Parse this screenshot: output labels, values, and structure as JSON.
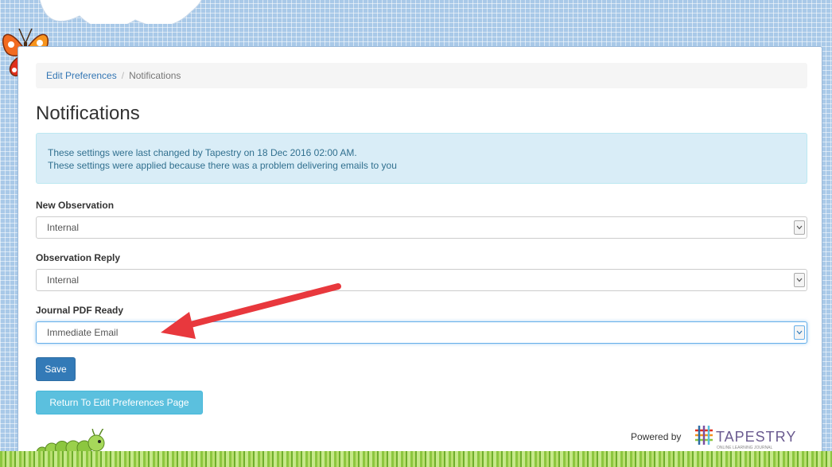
{
  "breadcrumb": {
    "parent": "Edit Preferences",
    "separator": "/",
    "current": "Notifications"
  },
  "page_title": "Notifications",
  "alert": {
    "line1": "These settings were last changed by Tapestry on 18 Dec 2016 02:00 AM.",
    "line2": "These settings were applied because there was a problem delivering emails to you"
  },
  "fields": [
    {
      "label": "New Observation",
      "value": "Internal"
    },
    {
      "label": "Observation Reply",
      "value": "Internal"
    },
    {
      "label": "Journal PDF Ready",
      "value": "Immediate Email"
    }
  ],
  "buttons": {
    "save": "Save",
    "return": "Return To Edit Preferences Page"
  },
  "footer": {
    "powered_by": "Powered by",
    "brand": "TAPESTRY",
    "brand_tagline": "ONLINE LEARNING JOURNAL"
  },
  "colors": {
    "primary": "#337ab7",
    "info": "#5bc0de",
    "alert_bg": "#d9edf7",
    "arrow": "#e8383d"
  }
}
